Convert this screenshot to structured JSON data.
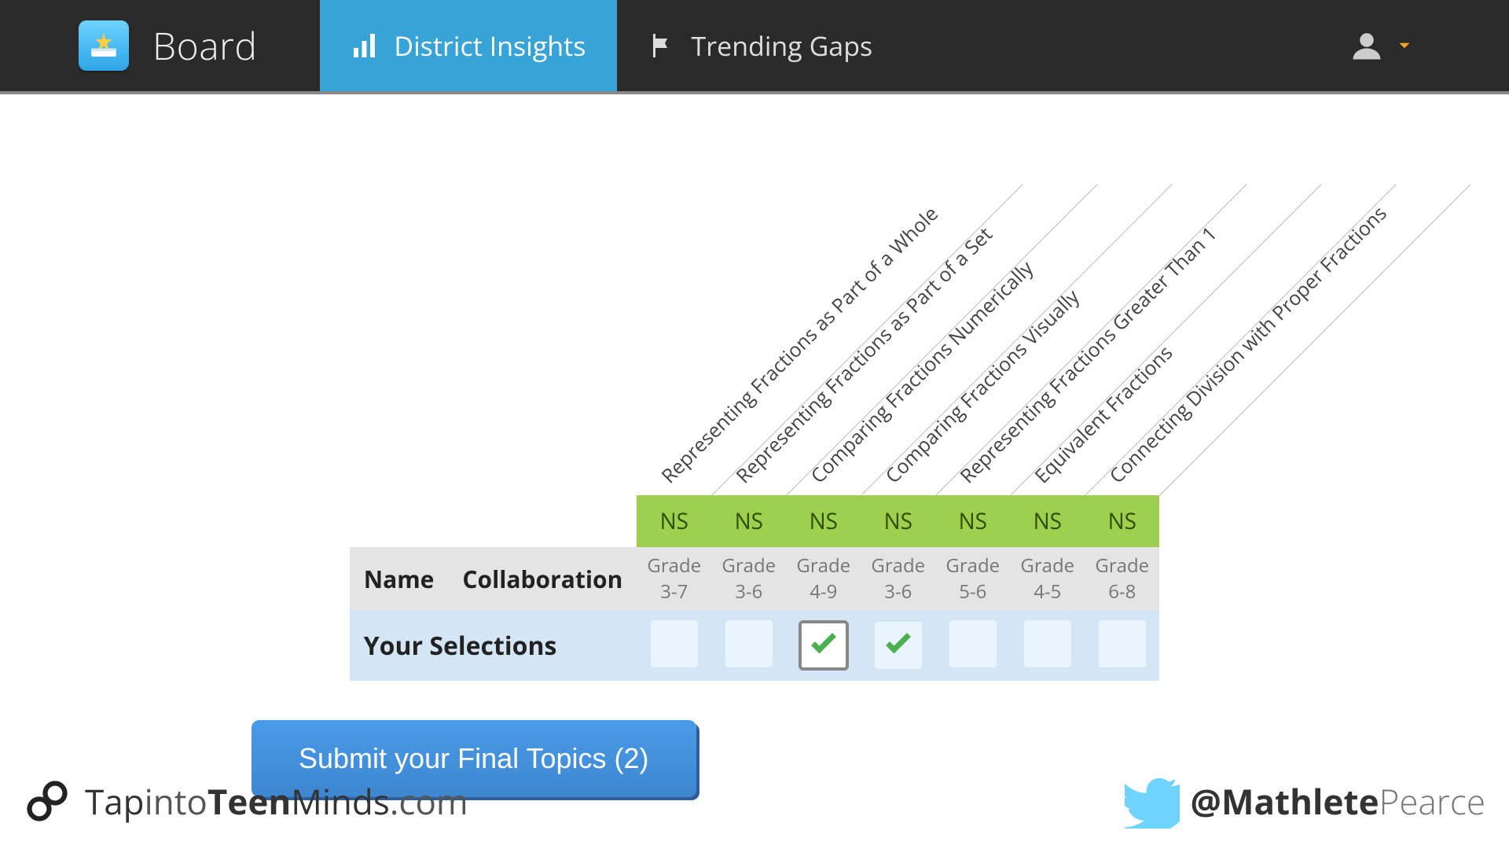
{
  "nav": {
    "title": "Board",
    "tabs": [
      {
        "id": "insights",
        "label": "District Insights",
        "active": true
      },
      {
        "id": "gaps",
        "label": "Trending Gaps",
        "active": false
      }
    ]
  },
  "table": {
    "columns": [
      {
        "topic": "Representing Fractions as Part of a Whole",
        "strand": "NS",
        "grades": "Grade 3-7",
        "selected": false,
        "focused": false
      },
      {
        "topic": "Representing Fractions as Part of a Set",
        "strand": "NS",
        "grades": "Grade 3-6",
        "selected": false,
        "focused": false
      },
      {
        "topic": "Comparing Fractions Numerically",
        "strand": "NS",
        "grades": "Grade 4-9",
        "selected": true,
        "focused": true
      },
      {
        "topic": "Comparing Fractions Visually",
        "strand": "NS",
        "grades": "Grade 3-6",
        "selected": true,
        "focused": false
      },
      {
        "topic": "Representing Fractions Greater Than 1",
        "strand": "NS",
        "grades": "Grade 5-6",
        "selected": false,
        "focused": false
      },
      {
        "topic": "Equivalent Fractions",
        "strand": "NS",
        "grades": "Grade 4-5",
        "selected": false,
        "focused": false
      },
      {
        "topic": "Connecting Division with Proper Fractions",
        "strand": "NS",
        "grades": "Grade 6-8",
        "selected": false,
        "focused": false
      }
    ],
    "row_labels": {
      "name": "Name",
      "collaboration": "Collaboration",
      "your_selections": "Your Selections"
    }
  },
  "submit": {
    "label": "Submit your Final Topics (2)"
  },
  "footer": {
    "site_parts": [
      "Tap",
      "into",
      "Teen",
      "Minds",
      ".com"
    ],
    "handle_parts": [
      "@Mathlete",
      "Pearce"
    ]
  }
}
